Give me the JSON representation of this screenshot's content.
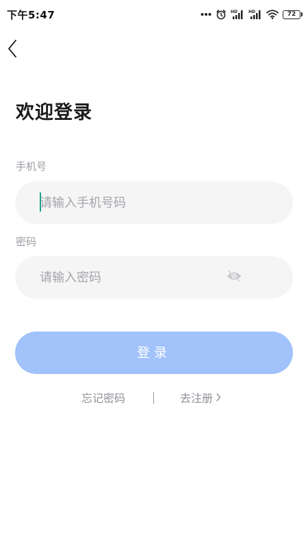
{
  "status_bar": {
    "time": "下午5:47",
    "battery_level": "72",
    "icons": [
      "more-dots-icon",
      "alarm-icon",
      "hd-signal-icon",
      "hd-signal-icon",
      "wifi-icon",
      "battery-icon"
    ],
    "hd_label": "HD"
  },
  "header": {
    "back_icon": "chevron-left-icon"
  },
  "login": {
    "title": "欢迎登录",
    "phone_label": "手机号",
    "phone_placeholder": "请输入手机号码",
    "phone_value": "",
    "password_label": "密码",
    "password_placeholder": "请输入密码",
    "password_value": "",
    "password_toggle_icon": "eye-icon",
    "submit_label": "登录"
  },
  "links": {
    "forgot_password": "忘记密码",
    "register": "去注册",
    "register_icon": "chevron-right-icon"
  },
  "colors": {
    "accent_button": "#a1c2fb",
    "input_bg": "#f5f5f6",
    "caret": "#1f9e8c",
    "muted_text": "#9a9da3"
  }
}
